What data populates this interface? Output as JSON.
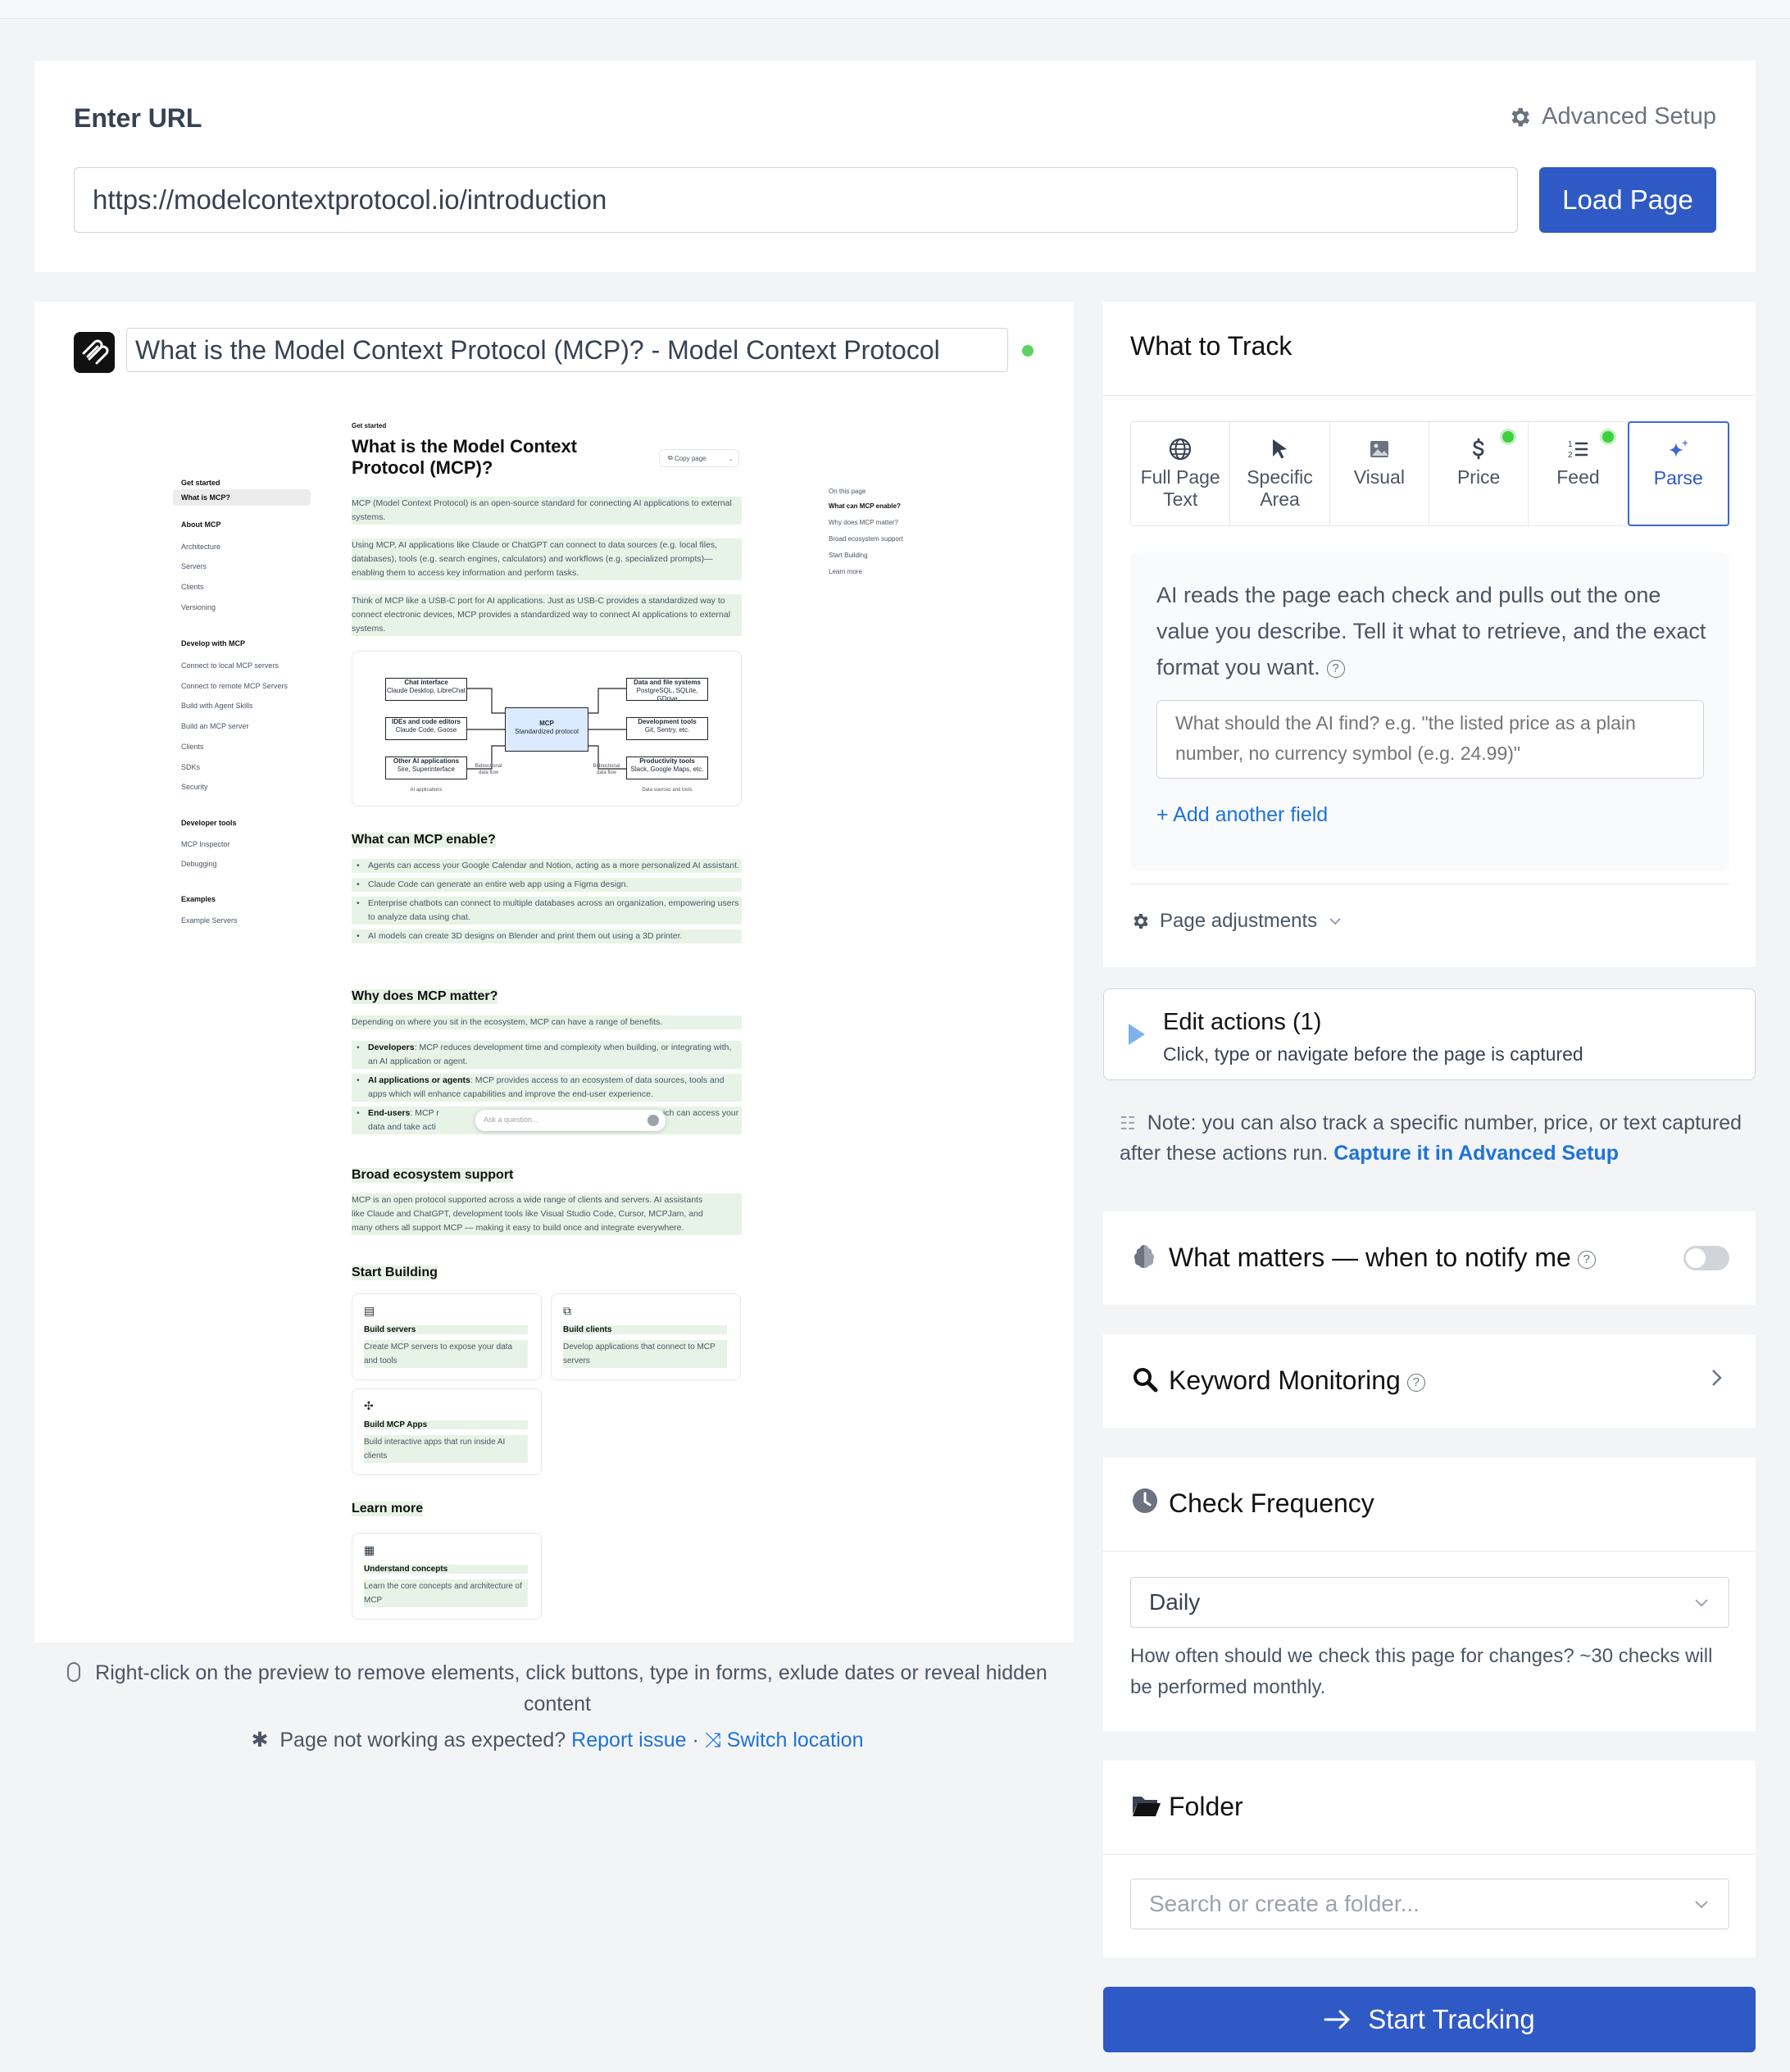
{
  "url_card": {
    "heading": "Enter URL",
    "advanced_setup": "Advanced Setup",
    "url_value": "https://modelcontextprotocol.io/introduction",
    "load_button": "Load Page"
  },
  "preview": {
    "page_title": "What is the Model Context Protocol (MCP)? - Model Context Protocol",
    "hint": "Right-click on the preview to remove elements, click buttons, type in forms, exlude dates or reveal hidden content",
    "issue_text": "Page not working as expected?",
    "report_issue": "Report issue",
    "separator": "·",
    "switch_location": "Switch location",
    "site": {
      "sidebar": [
        {
          "text": "Get started",
          "head": true
        },
        {
          "text": "What is MCP?",
          "active": true
        },
        {
          "text": "About MCP",
          "head": true
        },
        {
          "text": "Architecture"
        },
        {
          "text": "Servers"
        },
        {
          "text": "Clients"
        },
        {
          "text": "Versioning"
        },
        {
          "text": "Develop with MCP",
          "head": true
        },
        {
          "text": "Connect to local MCP servers"
        },
        {
          "text": "Connect to remote MCP Servers"
        },
        {
          "text": "Build with Agent Skills"
        },
        {
          "text": "Build an MCP server"
        },
        {
          "text": "Clients"
        },
        {
          "text": "SDKs"
        },
        {
          "text": "Security"
        },
        {
          "text": "Developer tools",
          "head": true
        },
        {
          "text": "MCP Inspector"
        },
        {
          "text": "Debugging"
        },
        {
          "text": "Examples",
          "head": true
        },
        {
          "text": "Example Servers"
        }
      ],
      "eyebrow": "Get started",
      "h1_line1": "What is the Model Context",
      "h1_line2": "Protocol (MCP)?",
      "copy_page": "Copy page",
      "p1": "MCP (Model Context Protocol) is an open-source standard for connecting AI applications to external systems.",
      "p2": "Using MCP, AI applications like Claude or ChatGPT can connect to data sources (e.g. local files, databases), tools (e.g. search engines, calculators) and workflows (e.g. specialized prompts)—enabling them to access key information and perform tasks.",
      "p3": "Think of MCP like a USB-C port for AI applications. Just as USB-C provides a standardized way to connect electronic devices, MCP provides a standardized way to connect AI applications to external systems.",
      "diagram": {
        "left": [
          [
            "Chat interface",
            "Claude Desktop, LibreChat"
          ],
          [
            "IDEs and code editors",
            "Claude Code, Goose"
          ],
          [
            "Other AI applications",
            "5ire, Superinterface"
          ]
        ],
        "center": [
          "MCP",
          "Standardized protocol"
        ],
        "right": [
          [
            "Data and file systems",
            "PostgreSQL, SQLite, GDrive"
          ],
          [
            "Development tools",
            "Git, Sentry, etc."
          ],
          [
            "Productivity tools",
            "Slack, Google Maps, etc."
          ]
        ],
        "left_caption": "AI applications",
        "right_caption": "Data sources and tools",
        "flow_left": "Bidirectional data flow",
        "flow_right": "Bidirectional data flow"
      },
      "h2_enable": "What can MCP enable?",
      "enable_items": [
        "Agents can access your Google Calendar and Notion, acting as a more personalized AI assistant.",
        "Claude Code can generate an entire web app using a Figma design.",
        "Enterprise chatbots can connect to multiple databases across an organization, empowering users to analyze data using chat.",
        "AI models can create 3D designs on Blender and print them out using a 3D printer."
      ],
      "h2_matter": "Why does MCP matter?",
      "matter_intro": "Depending on where you sit in the ecosystem, MCP can have a range of benefits.",
      "matter_items": [
        {
          "bold": "Developers",
          "text": ": MCP reduces development time and complexity when building, or integrating with, an AI application or agent."
        },
        {
          "bold": "AI applications or agents",
          "text": ": MCP provides access to an ecosystem of data sources, tools and apps which will enhance capabilities and improve the end-user experience."
        },
        {
          "bold": "End-users",
          "text": ": MCP r"
        }
      ],
      "end_users_tail": "ich can access your",
      "end_users_line2": "data and take acti",
      "ask_placeholder": "Ask a question...",
      "h2_eco": "Broad ecosystem support",
      "eco_line1": "MCP is an open protocol supported across a wide range of clients and servers. AI assistants",
      "eco_line2": "like Claude and ChatGPT, development tools like Visual Studio Code, Cursor, MCPJam, and",
      "eco_line3": "many others all support MCP — making it easy to build once and integrate everywhere.",
      "h2_build": "Start Building",
      "build_cards": [
        {
          "title": "Build servers",
          "desc": "Create MCP servers to expose your data and tools"
        },
        {
          "title": "Build clients",
          "desc": "Develop applications that connect to MCP servers"
        },
        {
          "title": "Build MCP Apps",
          "desc": "Build interactive apps that run inside AI clients"
        }
      ],
      "h2_learn": "Learn more",
      "learn_card": {
        "title": "Understand concepts",
        "desc": "Learn the core concepts and architecture of MCP"
      },
      "toc": [
        "On this page",
        "What can MCP enable?",
        "Why does MCP matter?",
        "Broad ecosystem support",
        "Start Building",
        "Learn more"
      ]
    }
  },
  "track": {
    "heading": "What to Track",
    "tabs": [
      {
        "label": "Full Page Text",
        "icon": "globe-icon"
      },
      {
        "label": "Specific Area",
        "icon": "cursor-icon"
      },
      {
        "label": "Visual",
        "icon": "image-icon"
      },
      {
        "label": "Price",
        "icon": "dollar-icon",
        "dot": true
      },
      {
        "label": "Feed",
        "icon": "list-icon",
        "dot": true
      },
      {
        "label": "Parse",
        "icon": "sparkle-icon",
        "active": true
      }
    ],
    "ai_description": "AI reads the page each check and pulls out the one value you describe. Tell it what to retrieve, and the exact format you want.",
    "ai_placeholder": "What should the AI find? e.g. \"the listed price as a plain number, no currency symbol (e.g. 24.99)\"",
    "add_field": "+ Add another field",
    "page_adjustments": "Page adjustments"
  },
  "edit_actions": {
    "title": "Edit actions (1)",
    "subtitle": "Click, type or navigate before the page is captured"
  },
  "note": {
    "text": "Note: you can also track a specific number, price, or text captured after these actions run.",
    "link": "Capture it in Advanced Setup"
  },
  "matters": {
    "title": "What matters — when to notify me",
    "enabled": false
  },
  "keyword": {
    "title": "Keyword Monitoring"
  },
  "frequency": {
    "title": "Check Frequency",
    "selected": "Daily",
    "help": "How often should we check this page for changes? ~30 checks will be performed monthly."
  },
  "folder": {
    "title": "Folder",
    "placeholder": "Search or create a folder..."
  },
  "start_button": "Start Tracking",
  "colors": {
    "primary": "#2f59c5",
    "link": "#1e73d8",
    "status_green": "#3ed13e",
    "highlight": "#e6f3e6"
  }
}
